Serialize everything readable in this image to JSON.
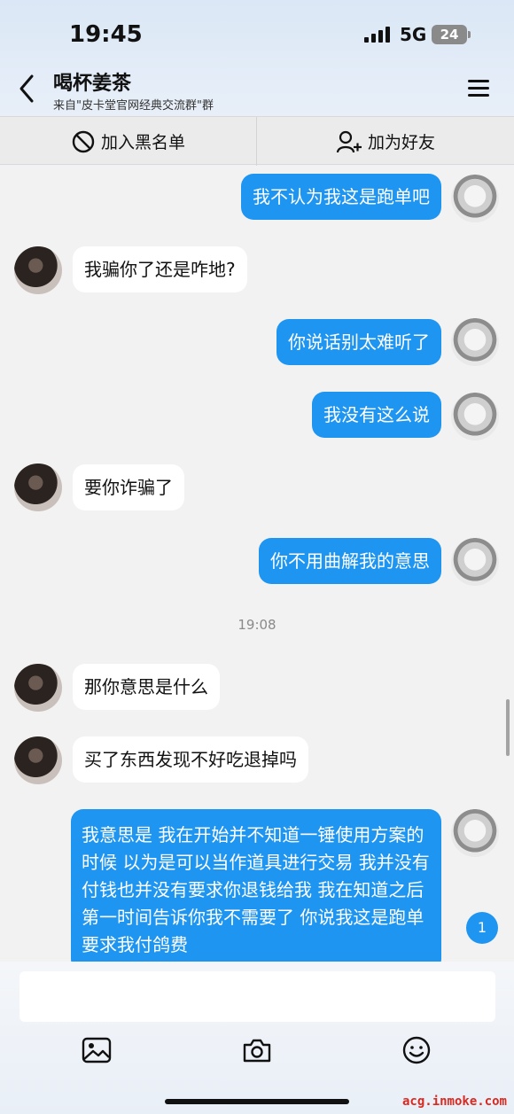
{
  "status": {
    "time": "19:45",
    "network": "5G",
    "battery": "24"
  },
  "header": {
    "contact_name": "喝杯姜茶",
    "subtitle": "来自\"皮卡堂官网经典交流群\"群",
    "back_icon": "chevron-left-icon",
    "menu_icon": "menu-icon"
  },
  "actions": {
    "blacklist_label": "加入黑名单",
    "add_friend_label": "加为好友"
  },
  "messages": [
    {
      "from": "me",
      "text": "我不认为我这是跑单吧"
    },
    {
      "from": "other",
      "text": "我骗你了还是咋地?"
    },
    {
      "from": "me",
      "text": "你说话别太难听了"
    },
    {
      "from": "me",
      "text": "我没有这么说"
    },
    {
      "from": "other",
      "text": "要你诈骗了"
    },
    {
      "from": "me",
      "text": "你不用曲解我的意思"
    },
    {
      "type": "timestamp",
      "text": "19:08"
    },
    {
      "from": "other",
      "text": "那你意思是什么"
    },
    {
      "from": "other",
      "text": "买了东西发现不好吃退掉吗"
    },
    {
      "from": "me",
      "text": "我意思是 我在开始并不知道一锤使用方案的时候 以为是可以当作道具进行交易 我并没有付钱也并没有要求你退钱给我 我在知道之后第一时间告诉你我不需要了 你说我这是跑单 要求我付鸽费"
    }
  ],
  "unread_count": "1",
  "toolbar": {
    "icons": [
      "image-icon",
      "camera-icon",
      "emoji-icon"
    ]
  },
  "watermark": "acg.inmoke.com",
  "colors": {
    "my_bubble": "#1f95f2",
    "other_bubble": "#ffffff",
    "background": "#f2f2f2"
  }
}
